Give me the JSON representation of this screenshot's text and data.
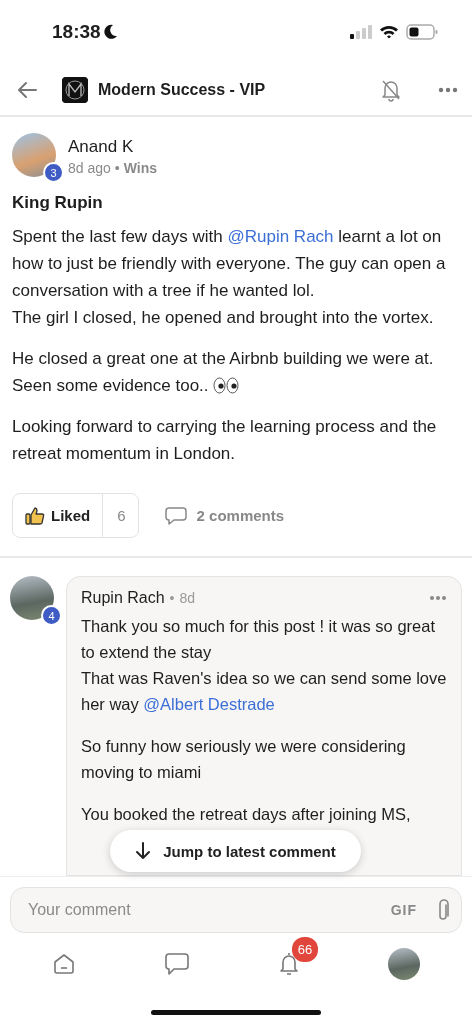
{
  "status_bar": {
    "time": "18:38"
  },
  "header": {
    "title": "Modern Success - VIP"
  },
  "post": {
    "author": "Anand K",
    "level_badge": "3",
    "time": "8d ago",
    "separator": "•",
    "category": "Wins",
    "title": "King Rupin",
    "paragraphs": [
      [
        [
          {
            "kind": "text",
            "text": "Spent the last few days with "
          },
          {
            "kind": "mention",
            "text": "@Rupin Rach"
          },
          {
            "kind": "text",
            "text": " learnt a lot on how to just be friendly with everyone. The guy can open a conversation with a tree if he wanted lol."
          }
        ],
        [
          {
            "kind": "text",
            "text": "The girl I closed, he opened and brought into the vortex."
          }
        ]
      ],
      [
        [
          {
            "kind": "text",
            "text": "He closed a great one at the Airbnb building we were at. Seen some evidence too.."
          },
          {
            "kind": "eyes"
          }
        ]
      ],
      [
        [
          {
            "kind": "text",
            "text": "Looking forward to carrying the learning process and the retreat momentum in London."
          }
        ]
      ]
    ],
    "like": {
      "label": "Liked",
      "count": "6",
      "selected": true
    },
    "comments_label": "2 comments"
  },
  "comment": {
    "author": "Rupin Rach",
    "level_badge": "4",
    "separator": "•",
    "time": "8d",
    "paragraphs": [
      [
        [
          {
            "kind": "text",
            "text": "Thank you so much for this post ! it was so great to extend the stay"
          }
        ],
        [
          {
            "kind": "text",
            "text": "That was Raven's idea so we can send some love her way "
          },
          {
            "kind": "mention",
            "text": "@Albert Destrade"
          }
        ]
      ],
      [
        [
          {
            "kind": "text",
            "text": "So funny how seriously we were considering moving to miami"
          }
        ]
      ],
      [
        [
          {
            "kind": "text",
            "text": "You booked the retreat days after joining MS,"
          }
        ]
      ]
    ]
  },
  "jump_button": "Jump to latest comment",
  "composer": {
    "placeholder": "Your comment",
    "gif": "GIF"
  },
  "bottom_nav": {
    "notification_badge": "66"
  }
}
